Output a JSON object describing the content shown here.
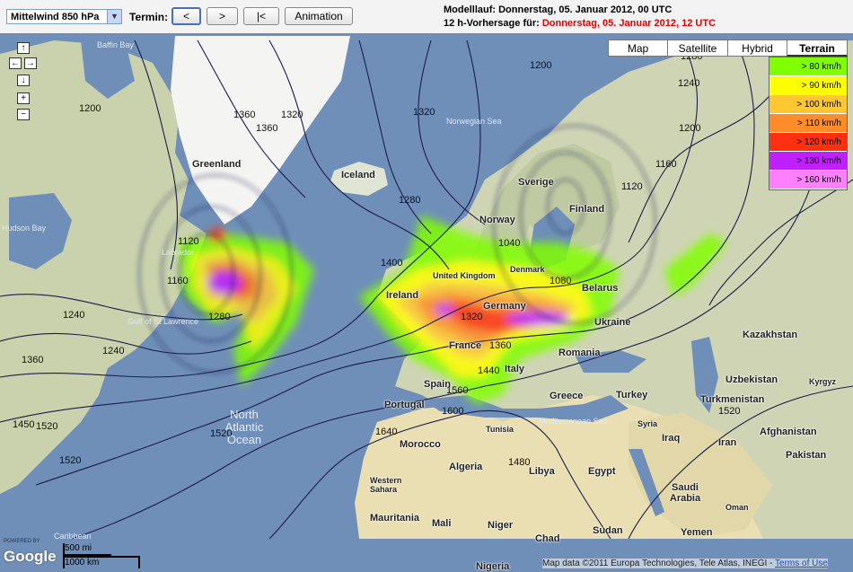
{
  "toolbar": {
    "select_value": "Mittelwind 850 hPa",
    "termin_label": "Termin:",
    "buttons": [
      {
        "label": "<",
        "active": true
      },
      {
        "label": ">",
        "active": false
      },
      {
        "label": "|<",
        "active": false
      },
      {
        "label": "Animation",
        "active": false
      }
    ],
    "info_line1": "Modelllauf: Donnerstag, 05. Januar 2012, 00 UTC",
    "info_line2_prefix": "12 h-Vorhersage für: ",
    "info_line2_date": "Donnerstag, 05. Januar 2012, 12 UTC"
  },
  "map_types": [
    {
      "label": "Map",
      "selected": false
    },
    {
      "label": "Satellite",
      "selected": false
    },
    {
      "label": "Hybrid",
      "selected": false
    },
    {
      "label": "Terrain",
      "selected": true
    }
  ],
  "legend": [
    {
      "label": "> 80 km/h",
      "color": "#80ff00"
    },
    {
      "label": "> 90 km/h",
      "color": "#ffff00"
    },
    {
      "label": "> 100 km/h",
      "color": "#ffc830"
    },
    {
      "label": "> 110 km/h",
      "color": "#ff8c28"
    },
    {
      "label": "> 120 km/h",
      "color": "#ff3010"
    },
    {
      "label": "> 130 km/h",
      "color": "#c020ff"
    },
    {
      "label": "> 160 km/h",
      "color": "#ff80ff"
    }
  ],
  "nav_controls": [
    "up-arrow",
    "left-arrow",
    "right-arrow",
    "down-arrow",
    "zoom-in",
    "zoom-out"
  ],
  "places": {
    "greenland": "Greenland",
    "iceland": "Iceland",
    "baffin": "Baffin Bay",
    "hudson": "Hudson Bay",
    "labrador": "Labrador",
    "gulf": "Gulf of St Lawrence",
    "norwegian": "Norwegian Sea",
    "sverige": "Sverige",
    "norway": "Norway",
    "finland": "Finland",
    "denmark": "Denmark",
    "uk": "United Kingdom",
    "ireland": "Ireland",
    "germany": "Germany",
    "belarus": "Belarus",
    "ukraine": "Ukraine",
    "france": "France",
    "romania": "Romania",
    "italy": "Italy",
    "spain": "Spain",
    "portugal": "Portugal",
    "greece": "Greece",
    "turkey": "Turkey",
    "kazakhstan": "Kazakhstan",
    "uzbekistan": "Uzbekistan",
    "kyrgyz": "Kyrgyz",
    "turkmenistan": "Turkmenistan",
    "afghanistan": "Afghanistan",
    "pakistan": "Pakistan",
    "iran": "Iran",
    "iraq": "Iraq",
    "syria": "Syria",
    "morocco": "Morocco",
    "tunisia": "Tunisia",
    "algeria": "Algeria",
    "libya": "Libya",
    "egypt": "Egypt",
    "saudi": "Saudi Arabia",
    "western_sahara": "Western Sahara",
    "mauritania": "Mauritania",
    "mali": "Mali",
    "niger": "Niger",
    "chad": "Chad",
    "sudan": "Sudan",
    "nigeria": "Nigeria",
    "yemen": "Yemen",
    "oman": "Oman",
    "caribbean": "Caribbean",
    "north_atlantic": "North Atlantic Ocean",
    "med": "Mediterranean Sea"
  },
  "isobars": [
    "1200",
    "1200",
    "1240",
    "1280",
    "1320",
    "1360",
    "1360",
    "1320",
    "1240",
    "1120",
    "1160",
    "1280",
    "1280",
    "1400",
    "1520",
    "1360",
    "1240",
    "1640",
    "1320",
    "1360",
    "1080",
    "1040",
    "1160",
    "1200",
    "1120",
    "1560",
    "1600",
    "1440",
    "1480",
    "1520",
    "1520",
    "1520",
    "1450"
  ],
  "scale": {
    "miles": "500 mi",
    "km": "1000 km"
  },
  "copyright": "Map data ©2011 Europa Technologies, Tele Atlas, INEGI - ",
  "terms_link": "Terms of Use",
  "powered_by": "POWERED BY",
  "logo": "Google"
}
